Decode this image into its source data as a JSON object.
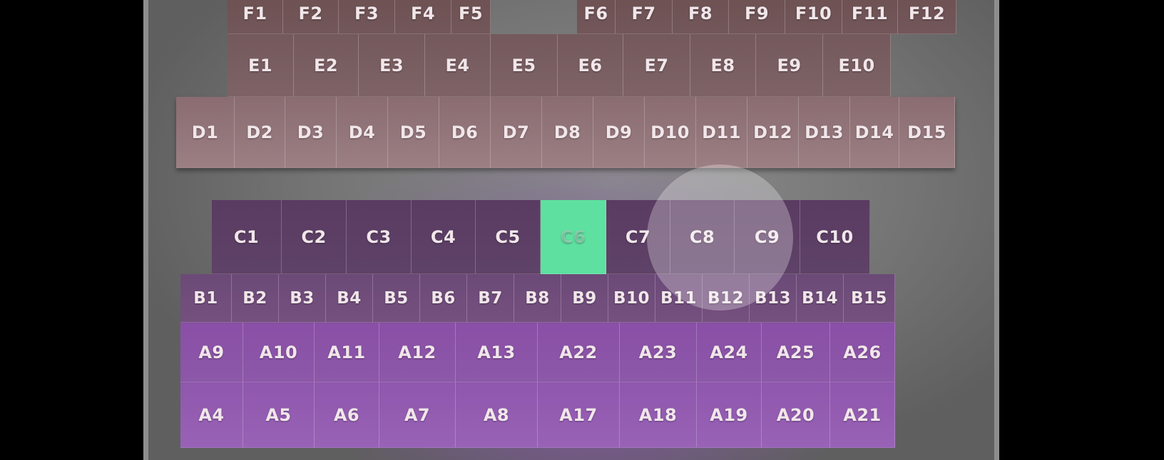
{
  "seat_map": {
    "selected_seat": "C6",
    "colors": {
      "selected": "#5de0a0",
      "row_f": "#6d5052",
      "row_e": "#7a5f62",
      "row_d": "#937579",
      "row_c": "#5c3f65",
      "row_b": "#704c7a",
      "row_a": "#9059ad"
    },
    "rows": {
      "F": [
        "F1",
        "F2",
        "F3",
        "F4",
        "F5",
        "F6",
        "F7",
        "F8",
        "F9",
        "F10",
        "F11",
        "F12"
      ],
      "E": [
        "E1",
        "E2",
        "E3",
        "E4",
        "E5",
        "E6",
        "E7",
        "E8",
        "E9",
        "E10"
      ],
      "D": [
        "D1",
        "D2",
        "D3",
        "D4",
        "D5",
        "D6",
        "D7",
        "D8",
        "D9",
        "D10",
        "D11",
        "D12",
        "D13",
        "D14",
        "D15"
      ],
      "C": [
        "C1",
        "C2",
        "C3",
        "C4",
        "C5",
        "C6",
        "C7",
        "C8",
        "C9",
        "C10"
      ],
      "B": [
        "B1",
        "B2",
        "B3",
        "B4",
        "B5",
        "B6",
        "B7",
        "B8",
        "B9",
        "B10",
        "B11",
        "B12",
        "B13",
        "B14",
        "B15"
      ],
      "A_upper": [
        "A9",
        "A10",
        "A11",
        "A12",
        "A13",
        "A22",
        "A23",
        "A24",
        "A25",
        "A26"
      ],
      "A_lower": [
        "A4",
        "A5",
        "A6",
        "A7",
        "A8",
        "A17",
        "A18",
        "A19",
        "A20",
        "A21"
      ]
    }
  }
}
